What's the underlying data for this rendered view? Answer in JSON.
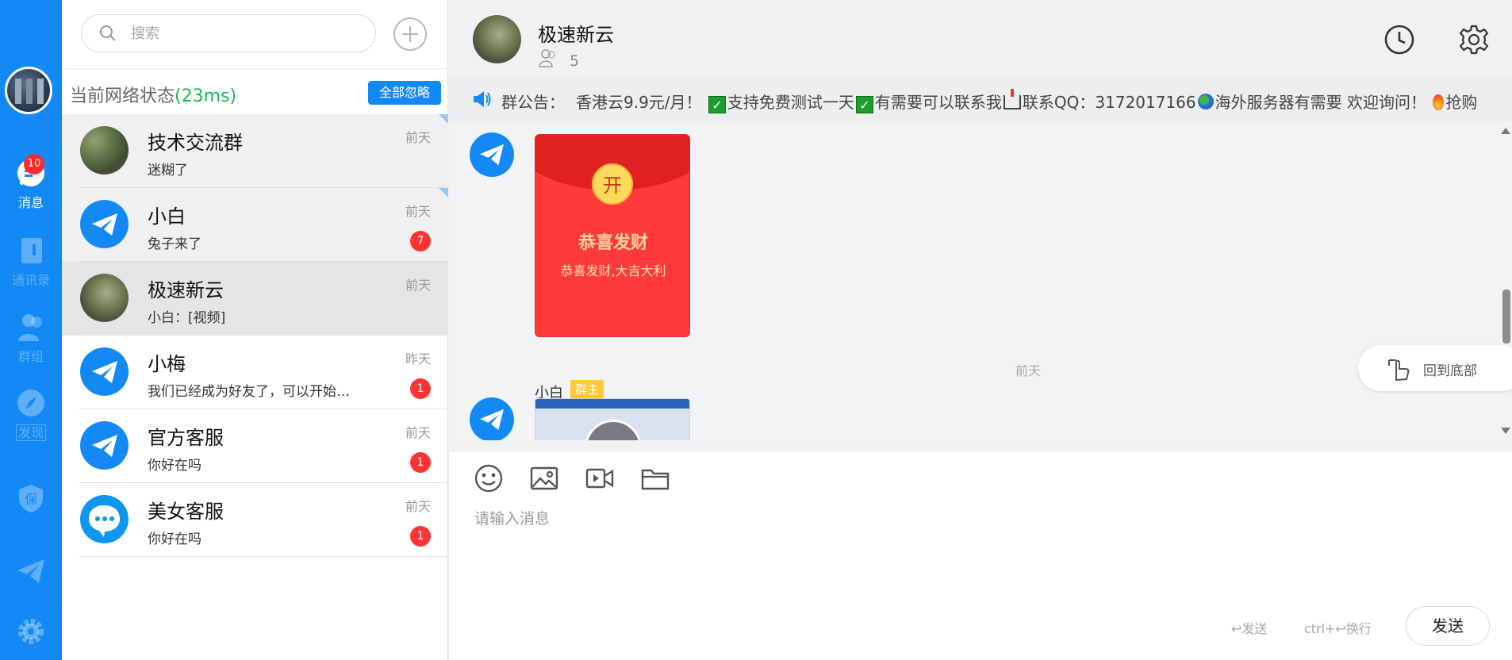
{
  "rail": {
    "badge_count": "10",
    "items": [
      {
        "label": "消息",
        "icon": "chat-bubble-icon"
      },
      {
        "label": "通讯录",
        "icon": "contacts-icon"
      },
      {
        "label": "群组",
        "icon": "group-icon"
      },
      {
        "label": "发现",
        "icon": "compass-icon"
      },
      {
        "label": "",
        "icon": "shield-icon"
      },
      {
        "label": "",
        "icon": "paper-plane-icon"
      },
      {
        "label": "",
        "icon": "gear-icon"
      }
    ]
  },
  "search": {
    "placeholder": "搜索"
  },
  "network": {
    "label": "当前网络状态",
    "latency": "(23ms)",
    "ignore_all": "全部忽略"
  },
  "conversations": [
    {
      "name": "技术交流群",
      "preview": "迷糊了",
      "time": "前天",
      "unread": "",
      "avatar": "photo"
    },
    {
      "name": "小白",
      "preview": "兔子来了",
      "time": "前天",
      "unread": "7",
      "avatar": "plane"
    },
    {
      "name": "极速新云",
      "preview": "小白：[视频]",
      "time": "前天",
      "unread": "",
      "avatar": "photo"
    },
    {
      "name": "小梅",
      "preview": "我们已经成为好友了，可以开始聊天了",
      "time": "昨天",
      "unread": "1",
      "avatar": "plane"
    },
    {
      "name": "官方客服",
      "preview": "你好在吗",
      "time": "前天",
      "unread": "1",
      "avatar": "plane"
    },
    {
      "name": "美女客服",
      "preview": "你好在吗",
      "time": "前天",
      "unread": "1",
      "avatar": "service"
    }
  ],
  "chat": {
    "title": "极速新云",
    "member_count": "5",
    "notice_label": "群公告：",
    "notice": {
      "p1": "香港云9.9元/月！",
      "p2": "支持免费测试一天",
      "p3": "有需要可以联系我",
      "p4": "联系QQ：3172017166",
      "p5": "海外服务器有需要 欢迎询问！",
      "p6": "抢购"
    },
    "red_packet": {
      "open": "开",
      "title": "恭喜发财",
      "subtitle": "恭喜发财,大吉大利"
    },
    "divider_time": "前天",
    "second_sender": "小白",
    "second_role": "群主",
    "back_to_bottom": "回到底部"
  },
  "composer": {
    "placeholder": "请输入消息",
    "hint_send": "↩发送",
    "hint_newline": "ctrl+↩换行",
    "send": "发送"
  }
}
